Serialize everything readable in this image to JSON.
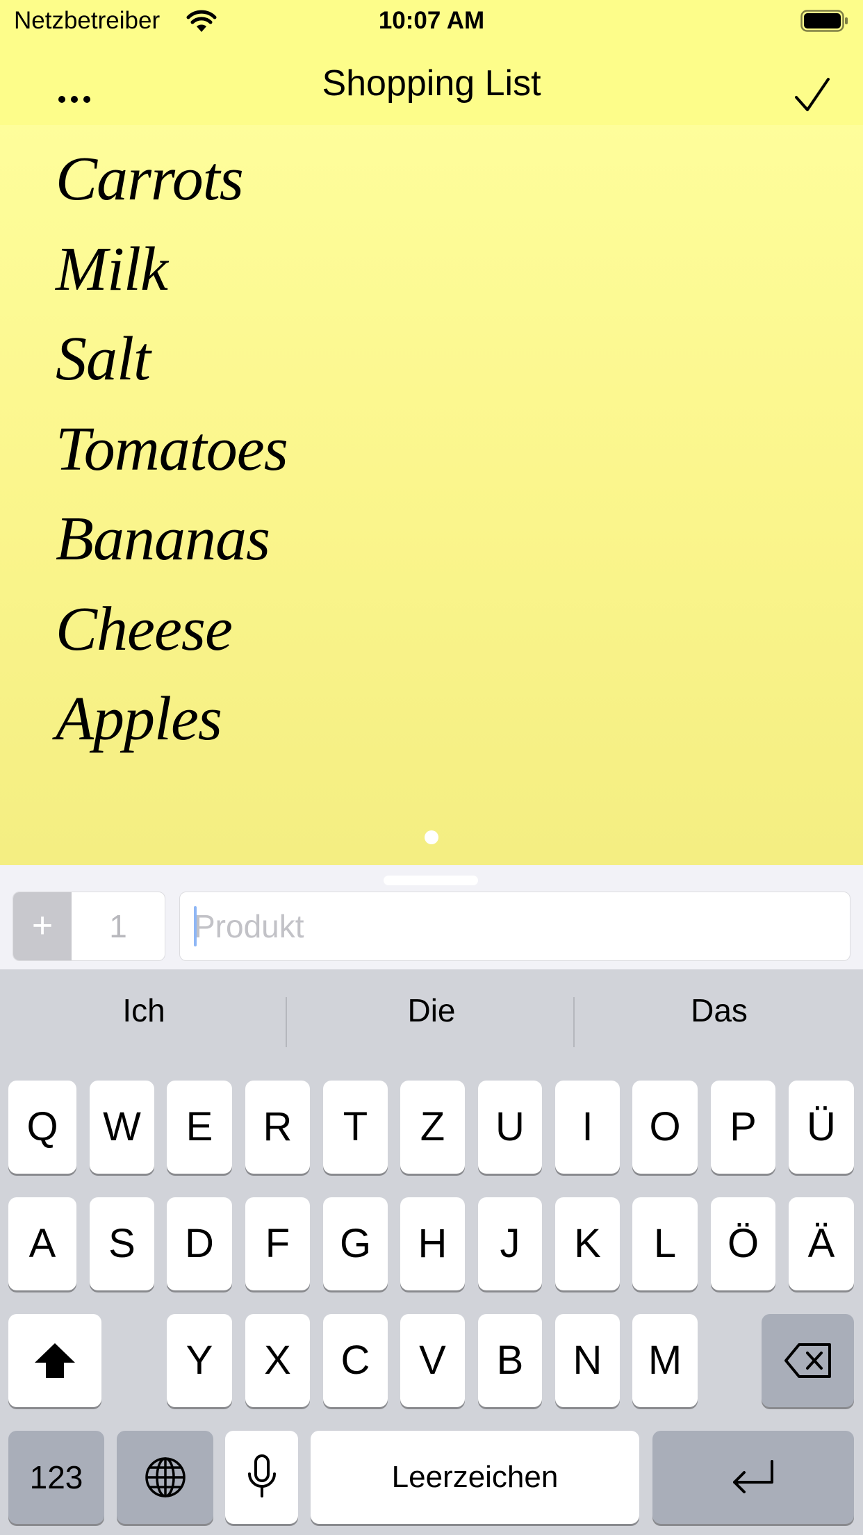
{
  "status_bar": {
    "carrier": "Netzbetreiber",
    "time": "10:07 AM"
  },
  "nav": {
    "title": "Shopping List"
  },
  "list": {
    "items": [
      "Carrots",
      "Milk",
      "Salt",
      "Tomatoes",
      "Bananas",
      "Cheese",
      "Apples"
    ]
  },
  "input_bar": {
    "plus_label": "+",
    "quantity": "1",
    "product_placeholder": "Produkt"
  },
  "keyboard": {
    "suggestions": [
      "Ich",
      "Die",
      "Das"
    ],
    "row1": [
      "Q",
      "W",
      "E",
      "R",
      "T",
      "Z",
      "U",
      "I",
      "O",
      "P",
      "Ü"
    ],
    "row2": [
      "A",
      "S",
      "D",
      "F",
      "G",
      "H",
      "J",
      "K",
      "L",
      "Ö",
      "Ä"
    ],
    "row3": [
      "Y",
      "X",
      "C",
      "V",
      "B",
      "N",
      "M"
    ],
    "numbers_label": "123",
    "space_label": "Leerzeichen"
  },
  "colors": {
    "note_yellow": "#fdfd8c",
    "keyboard_bg": "#d1d3d9",
    "caret_blue": "#8eb6f5"
  }
}
